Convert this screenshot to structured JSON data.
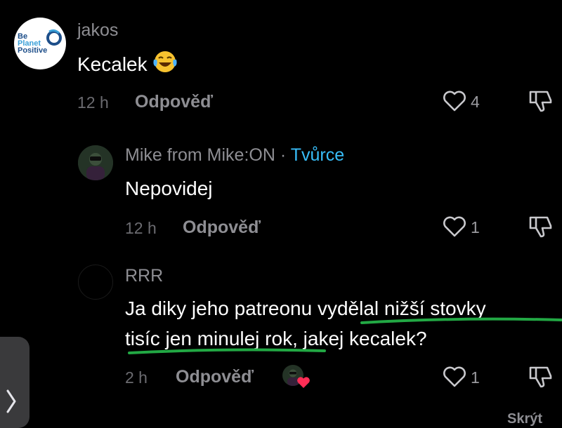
{
  "comments": [
    {
      "username": "jakos",
      "avatar_text": [
        "Be",
        "Planet",
        "Positive"
      ],
      "text": "Kecalek",
      "emoji": "laughing-tears-emoji",
      "time": "12 h",
      "reply_label": "Odpověď",
      "likes": "4"
    },
    {
      "username": "Mike from Mike:ON",
      "separator": "·",
      "creator_tag": "Tvůrce",
      "text": "Nepovidej",
      "time": "12 h",
      "reply_label": "Odpověď",
      "likes": "1"
    },
    {
      "username": "RRR",
      "text_line1_a": "Ja diky jeho patreonu ",
      "text_line1_b": "vydělal nižší stovky",
      "text_line2_a": "tisíc jen minulej rok",
      "text_line2_b": ", jakej kecalek?",
      "time": "2 h",
      "reply_label": "Odpověď",
      "likes": "1"
    }
  ],
  "footer": {
    "hide_label": "Skrýt"
  },
  "colors": {
    "accent": "#38bdf8",
    "highlight_underline": "#22a844",
    "heart_red": "#ff2d55"
  },
  "icons": [
    "heart-outline-icon",
    "dislike-icon",
    "chevron-right-icon"
  ]
}
